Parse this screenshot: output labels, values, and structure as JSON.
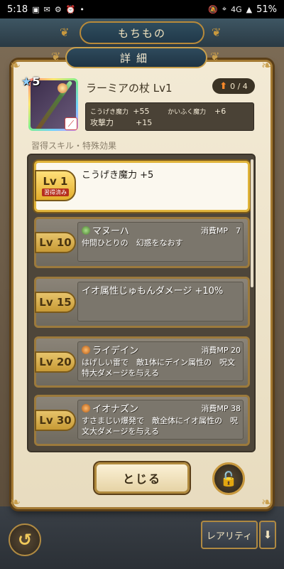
{
  "status_bar": {
    "time": "5:18",
    "network": "4G",
    "battery": "51%"
  },
  "background": {
    "title": "もちもの",
    "rarity_label": "レアリティ",
    "sort_icon": "down-arrow"
  },
  "modal": {
    "title": "詳細",
    "item": {
      "stars": "5",
      "name": "ラーミアの杖 Lv1",
      "upgrade": "0 / 4",
      "stats": [
        {
          "label": "こうげき魔力",
          "value": "+55",
          "label2": "かいふく魔力",
          "value2": "+6"
        },
        {
          "label": "攻撃力",
          "value": "+15",
          "label2": "",
          "value2": ""
        }
      ]
    },
    "section_label": "習得スキル・特殊効果",
    "skills": [
      {
        "level": "Lv 1",
        "acquired": "習得済み",
        "name": "こうげき魔力 +5",
        "mp": "",
        "desc": "",
        "orb": ""
      },
      {
        "level": "Lv 10",
        "acquired": "",
        "name": "マヌーハ",
        "mp": "消費MP　7",
        "desc": "仲間ひとりの　幻惑をなおす",
        "orb": "green"
      },
      {
        "level": "Lv 15",
        "acquired": "",
        "name": "イオ属性じゅもんダメージ +10%",
        "mp": "",
        "desc": "",
        "orb": ""
      },
      {
        "level": "Lv 20",
        "acquired": "",
        "name": "ライデイン",
        "mp": "消費MP 20",
        "desc": "はげしい雷で　敵1体にデイン属性の　呪文特大ダメージを与える",
        "orb": "orange"
      },
      {
        "level": "Lv 30",
        "acquired": "",
        "name": "イオナズン",
        "mp": "消費MP 38",
        "desc": "すさまじい爆発で　敵全体にイオ属性の　呪文大ダメージを与える",
        "orb": "orange"
      }
    ],
    "close_label": "とじる"
  }
}
